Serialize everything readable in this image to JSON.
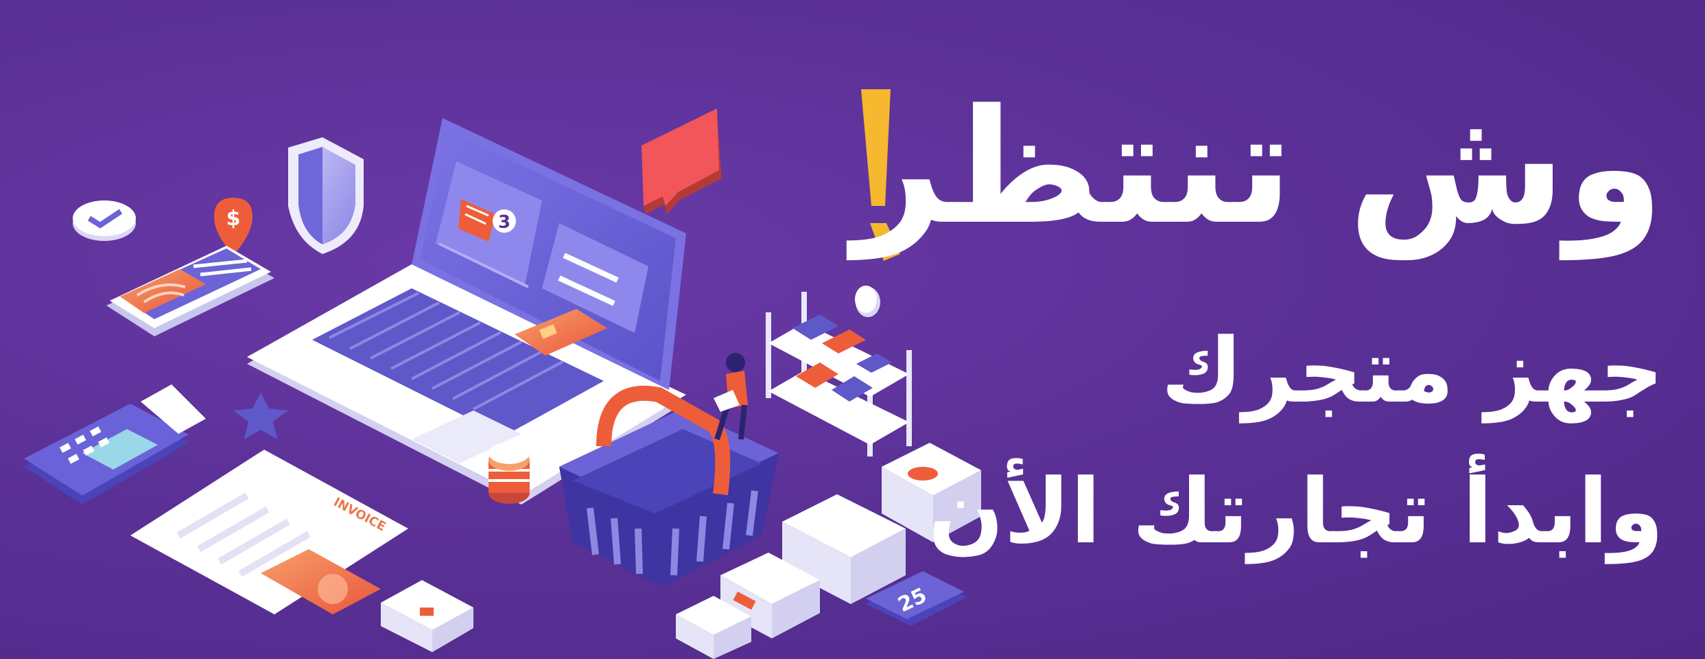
{
  "headline": {
    "title": "وش تنتظر",
    "exclamation": "!",
    "line1": "جهز متجرك",
    "line2": "وابدأ تجارتك الأن"
  },
  "illustration": {
    "invoice_label": "INVOICE",
    "basket_count": "3",
    "price_tag_value": "25",
    "dollar_symbol": "$"
  },
  "colors": {
    "background": "#5b3197",
    "accent_yellow": "#f5b82e",
    "accent_orange": "#ee5d3a",
    "text": "#ffffff"
  },
  "icons": [
    "shield-icon",
    "chat-bubble-icon",
    "fingerprint-icon",
    "location-pin-icon",
    "star-icon",
    "shopping-basket-icon",
    "laptop-icon",
    "credit-card-icon",
    "pos-terminal-icon",
    "invoice-icon",
    "box-icon",
    "shelf-icon",
    "price-tag-icon",
    "coin-stack-icon",
    "checkmark-icon"
  ]
}
